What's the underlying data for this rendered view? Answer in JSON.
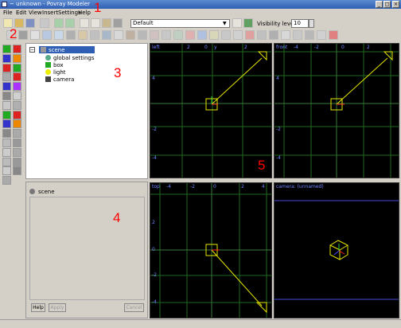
{
  "window": {
    "title": "~ unknown - Povray Modeler"
  },
  "menu": [
    "File",
    "Edit",
    "View",
    "Insert",
    "Settings",
    "Help"
  ],
  "toolbar": {
    "layout_select": "Default",
    "visibility_label": "Visibility level:",
    "visibility_value": "10"
  },
  "tree": {
    "root": "scene",
    "children": [
      "global settings",
      "box",
      "light",
      "camera"
    ]
  },
  "properties": {
    "title": "scene",
    "help_button": "Help",
    "apply_button": "Apply",
    "cancel_button": "Cancel"
  },
  "views": [
    {
      "name": "left",
      "axis": "y",
      "ticks_x": [
        "2",
        "0",
        "2"
      ],
      "ticks_y": [
        "4",
        "2",
        "0",
        "-2",
        "-4"
      ]
    },
    {
      "name": "front",
      "axis": "z",
      "ticks_x": [
        "-4",
        "-2",
        "0",
        "2"
      ],
      "ticks_y": [
        "4",
        "2",
        "0",
        "-2",
        "-4"
      ]
    },
    {
      "name": "top",
      "axis": "x",
      "ticks_x": [
        "-4",
        "-2",
        "0",
        "2",
        "4"
      ],
      "ticks_y": [
        "2",
        "0",
        "-2",
        "-4"
      ]
    },
    {
      "name": "camera: (unnamed)"
    }
  ],
  "annotations": [
    "1",
    "2",
    "3",
    "4",
    "5"
  ],
  "colors": {
    "axis_blue": "#6f84ff",
    "grid_green": "#1f6a1f",
    "selection_yellow": "#e6e600",
    "axis_red": "#ff2020"
  }
}
